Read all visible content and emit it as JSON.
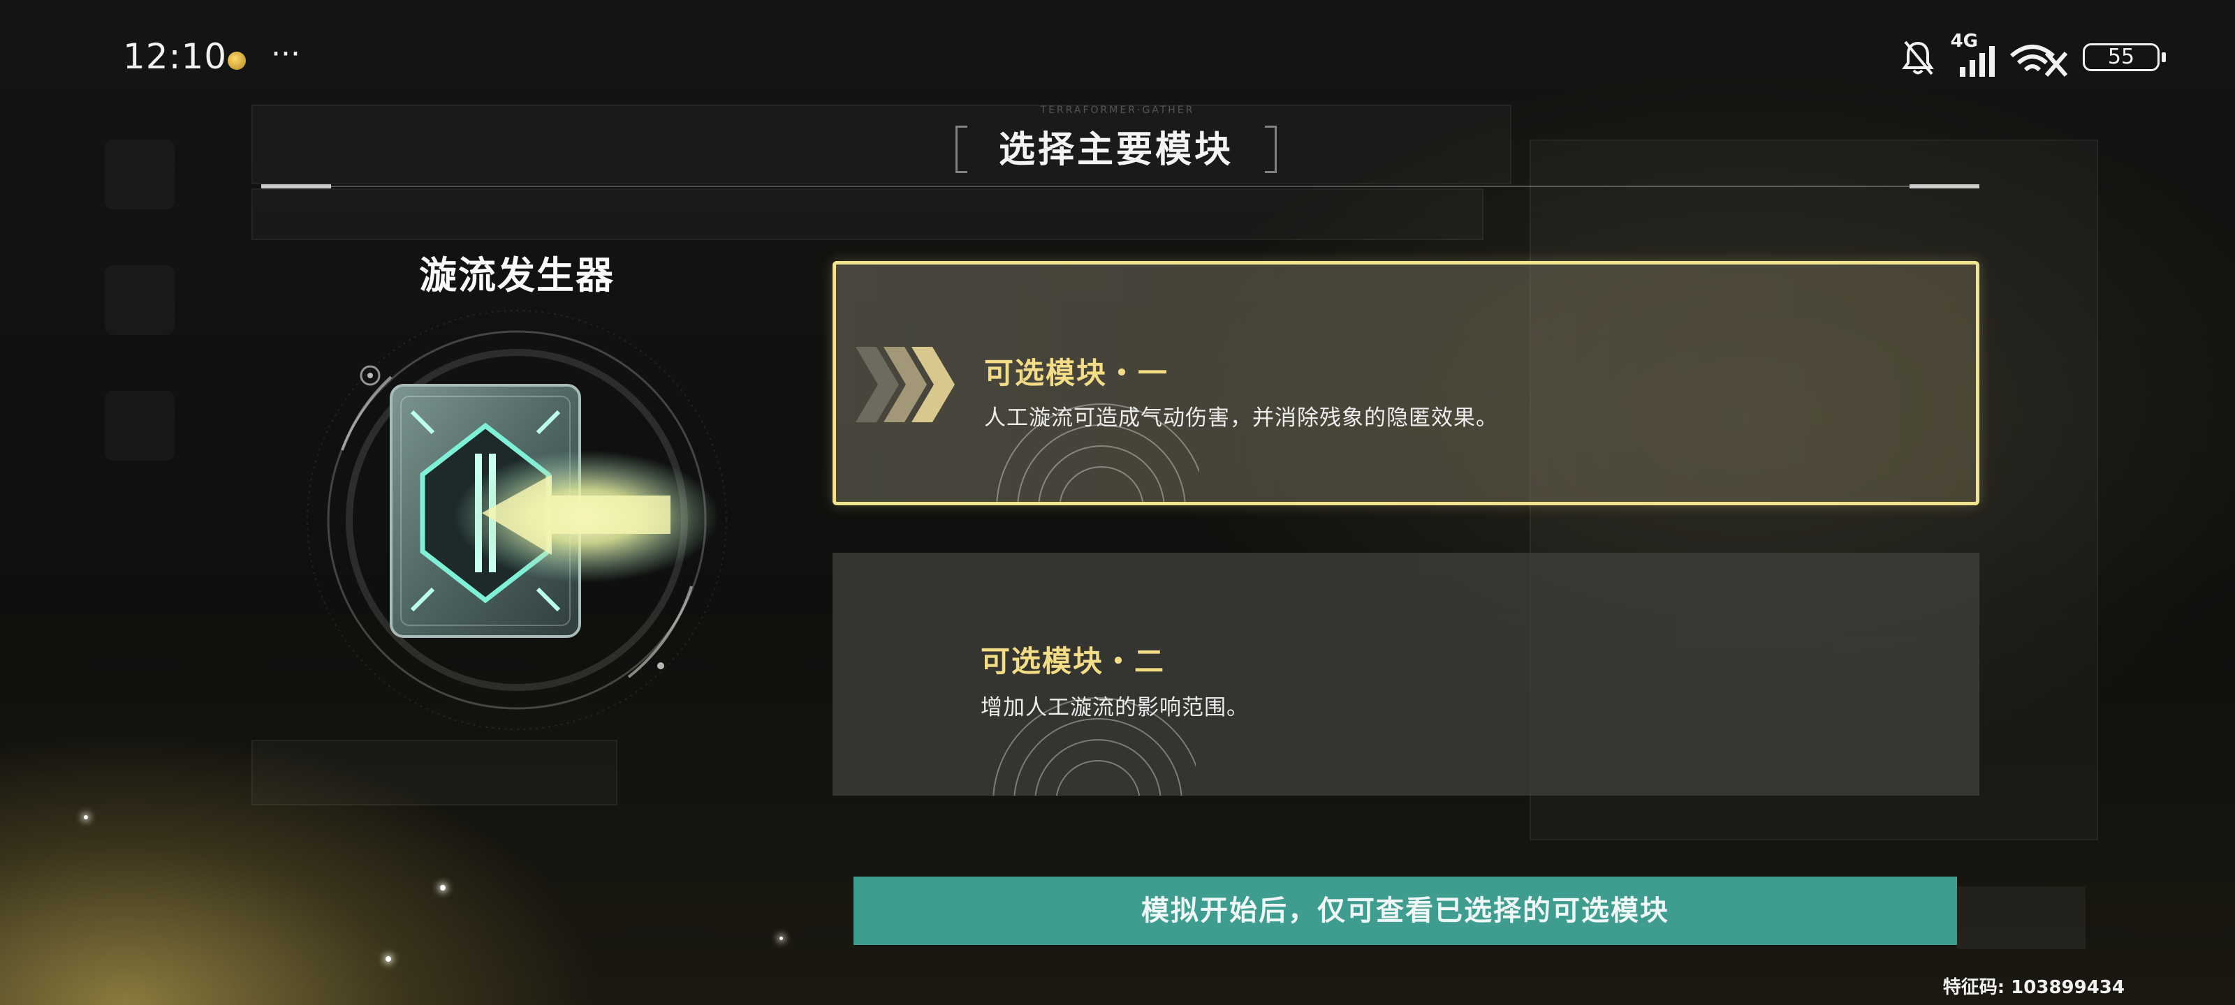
{
  "status_bar": {
    "time": "12:10",
    "more": "···",
    "network": "4G",
    "battery": "55"
  },
  "header": {
    "title": "选择主要模块",
    "subtitle": "TERRAFORMER·GATHER"
  },
  "module": {
    "name": "漩流发生器"
  },
  "options": [
    {
      "title": "可选模块・一",
      "description": "人工漩流可造成气动伤害，并消除残象的隐匿效果。",
      "selected": true
    },
    {
      "title": "可选模块・二",
      "description": "增加人工漩流的影响范围。",
      "selected": false
    }
  ],
  "notice": "模拟开始后，仅可查看已选择的可选模块",
  "feature_code": "特征码: 103899434",
  "colors": {
    "selected_border": "#f1e491",
    "option_title": "#f2dc86",
    "notice_bg": "#3f9d8f"
  }
}
